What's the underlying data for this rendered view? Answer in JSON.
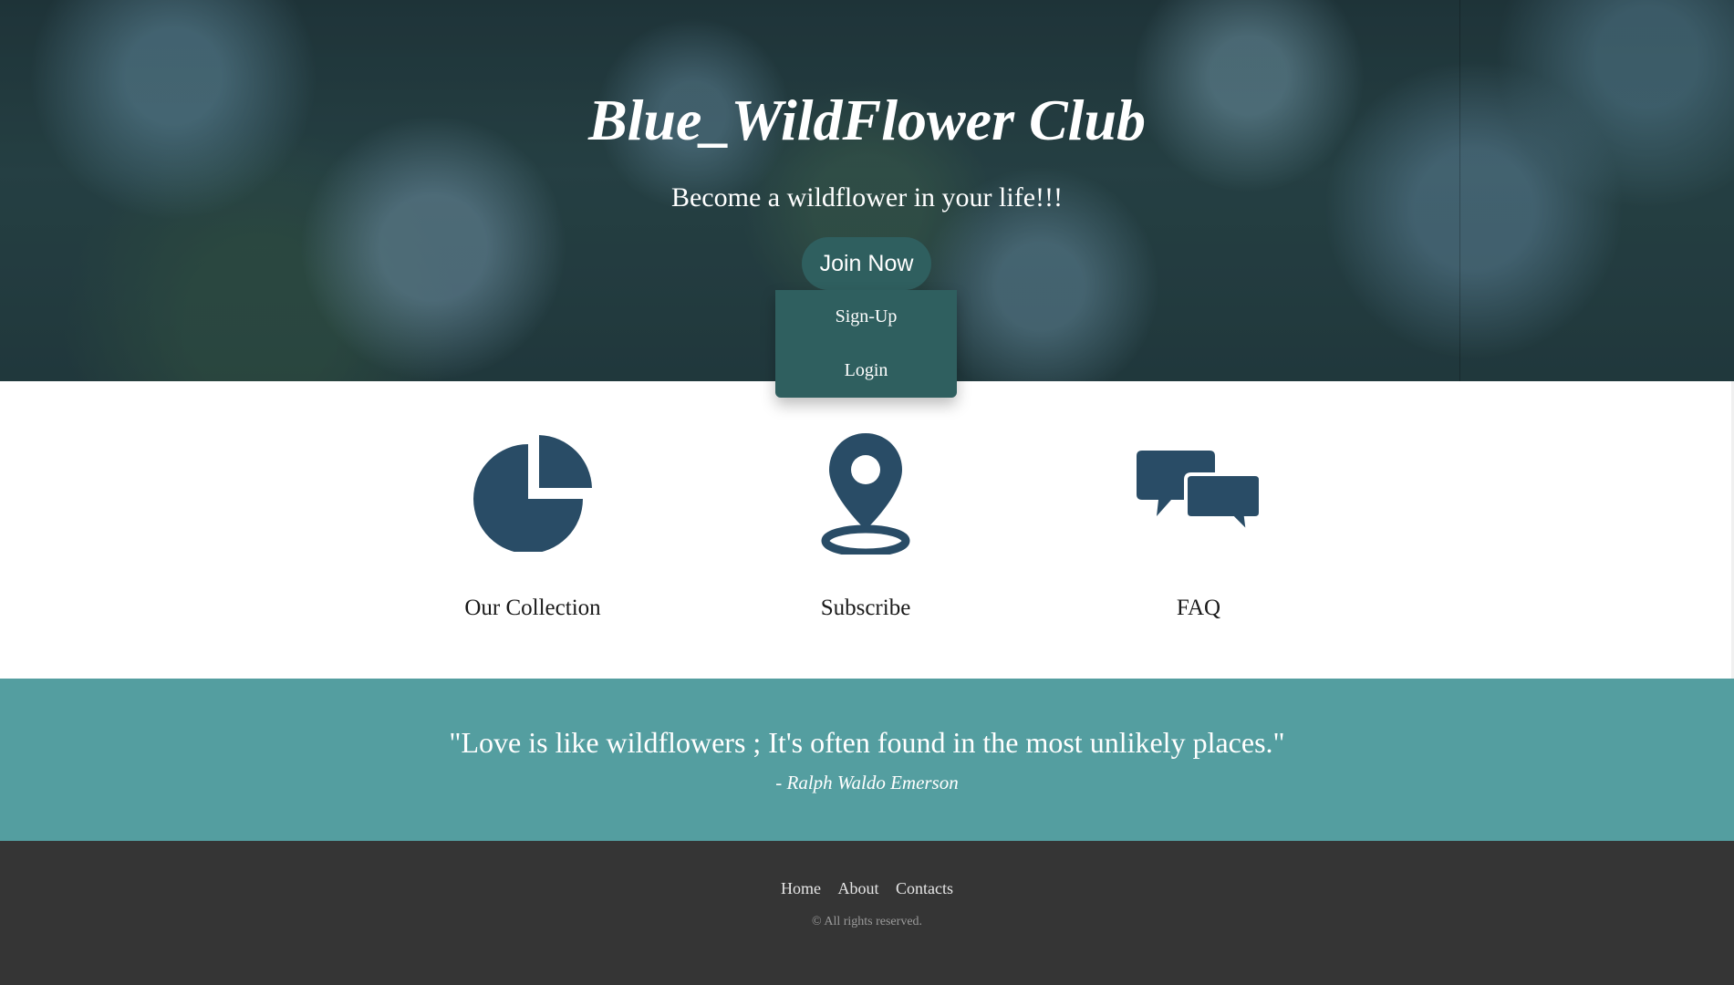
{
  "hero": {
    "title": "Blue_WildFlower Club",
    "subtitle": "Become a wildflower in your life!!!",
    "cta_label": "Join Now",
    "dropdown": [
      "Sign-Up",
      "Login"
    ]
  },
  "features": [
    {
      "label": "Our Collection",
      "icon": "pie-chart-icon"
    },
    {
      "label": "Subscribe",
      "icon": "map-pin-icon"
    },
    {
      "label": "FAQ",
      "icon": "chat-bubbles-icon"
    }
  ],
  "quote": {
    "text": "\"Love is like wildflowers ; It's often found in the most unlikely places.\"",
    "author": "- Ralph Waldo Emerson"
  },
  "footer": {
    "links": [
      "Home",
      "About",
      "Contacts"
    ],
    "copyright": "© All rights reserved."
  },
  "colors": {
    "icon": "#294c66",
    "button": "#2f5f5f",
    "quote_band": "#549ea0",
    "footer": "#353535"
  }
}
